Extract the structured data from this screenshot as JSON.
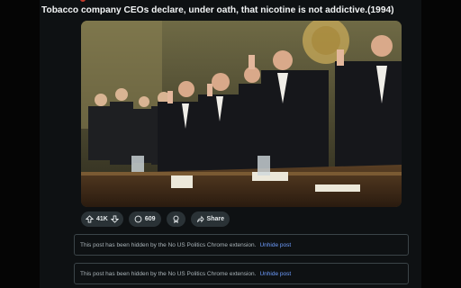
{
  "post": {
    "title": "Tobacco company CEOs declare, under oath, that nicotine is not addictive.(1994)",
    "image_icon": "photo-of-executives-taking-oath"
  },
  "actions": {
    "vote_count": "41K",
    "comment_count": "609",
    "award_icon": "award-icon",
    "share_label": "Share"
  },
  "hidden_posts": [
    {
      "message": "This post has been hidden by the No US Politics Chrome extension.",
      "link": "Unhide post"
    },
    {
      "message": "This post has been hidden by the No US Politics Chrome extension.",
      "link": "Unhide post"
    }
  ],
  "colors": {
    "background": "#0e1113",
    "pill": "#2a3236",
    "link": "#6e9dff"
  }
}
